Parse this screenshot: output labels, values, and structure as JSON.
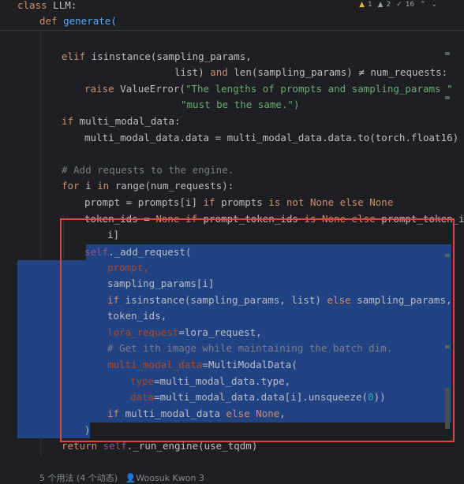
{
  "sticky": {
    "line1": {
      "kw": "class",
      "name": "LLM:"
    },
    "line2": {
      "kw": "def",
      "name": "generate("
    }
  },
  "inspections": {
    "warnings": "1",
    "weak_warnings": "2",
    "typos": "16"
  },
  "code": {
    "l_elif_a": "elif",
    "l_elif_b": " isinstance(sampling_params,",
    "l_list_a": "list)",
    "l_list_b": " and ",
    "l_list_c": "len(sampling_params) ≠ num_requests:",
    "l_raise_a": "raise",
    "l_raise_b": " ValueError(",
    "l_raise_c": "\"The lengths of prompts and sampling_params \"",
    "l_must": "\"must be the same.\")",
    "l_if_a": "if",
    "l_if_b": " multi_modal_data:",
    "l_mmd": "multi_modal_data.data = multi_modal_data.data.to(torch.float16)",
    "l_comment1": "# Add requests to the engine.",
    "l_for_a": "for",
    "l_for_b": " i ",
    "l_for_c": "in",
    "l_for_d": " range(num_requests):",
    "l_prompt_a": "prompt = prompts[i] ",
    "l_prompt_b": "if",
    "l_prompt_c": " prompts ",
    "l_prompt_d": "is not None else None",
    "l_tok_a": "token_ids = ",
    "l_tok_b": "None if",
    "l_tok_c": " prompt_token_ids ",
    "l_tok_d": "is None else",
    "l_tok_e": " prompt_token_i",
    "l_tok2": "i]",
    "l_self_a": "self",
    "l_self_b": "._add_request(",
    "l_a1": "prompt,",
    "l_a2": "sampling_params[i]",
    "l_a3_a": "if",
    "l_a3_b": " isinstance(sampling_params, list) ",
    "l_a3_c": "else",
    "l_a3_d": " sampling_params,",
    "l_a4": "token_ids,",
    "l_a5_a": "lora_request",
    "l_a5_b": "=lora_request,",
    "l_a6": "# Get ith image while maintaining the batch dim.",
    "l_a7_a": "multi_modal_data",
    "l_a7_b": "=MultiModalData(",
    "l_a8_a": "type",
    "l_a8_b": "=multi_modal_data.type,",
    "l_a9_a": "data",
    "l_a9_b": "=multi_modal_data.data[i].unsqueeze(",
    "l_a9_c": "0",
    "l_a9_d": "))",
    "l_a10_a": "if",
    "l_a10_b": " multi_modal_data ",
    "l_a10_c": "else None",
    "l_a10_d": ",",
    "l_close": ")",
    "l_ret_a": "return",
    "l_ret_b": " self",
    "l_ret_c": "._run_engine(use_tqdm)"
  },
  "footer": {
    "usages": "5 个用法 (4 个动态)",
    "author": "Woosuk Kwon 3"
  },
  "colors": {
    "selection": "#214283",
    "highlight_box": "#e0443e",
    "keyword": "#cf8e6d",
    "string": "#6aab73"
  }
}
